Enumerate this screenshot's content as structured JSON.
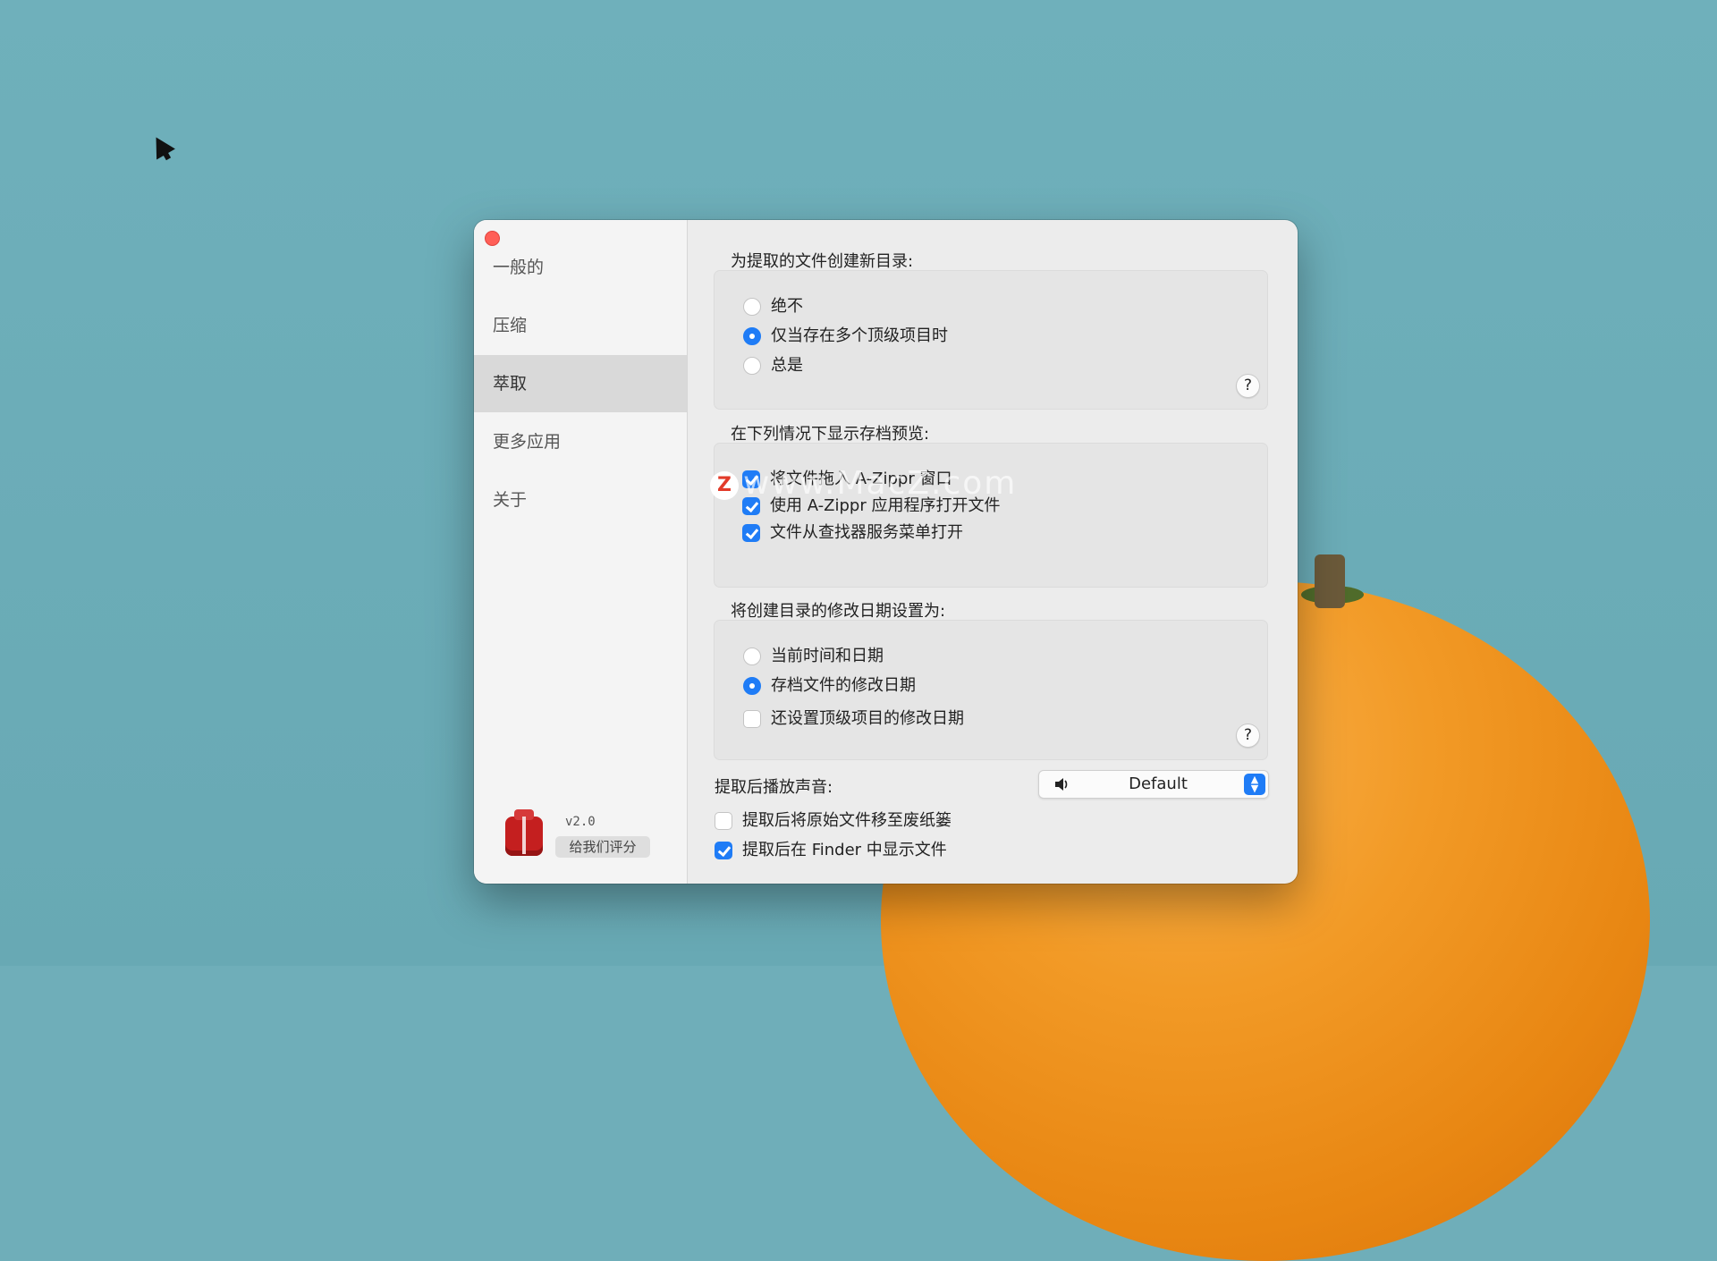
{
  "sidebar": {
    "items": [
      {
        "label": "一般的"
      },
      {
        "label": "压缩"
      },
      {
        "label": "萃取"
      },
      {
        "label": "更多应用"
      },
      {
        "label": "关于"
      }
    ],
    "active_index": 2,
    "version": "v2.0",
    "rate_button": "给我们评分"
  },
  "main": {
    "create_dir": {
      "title": "为提取的文件创建新目录:",
      "options": [
        {
          "label": "绝不",
          "selected": false
        },
        {
          "label": "仅当存在多个顶级项目时",
          "selected": true
        },
        {
          "label": "总是",
          "selected": false
        }
      ],
      "help": "?"
    },
    "preview": {
      "title": "在下列情况下显示存档预览:",
      "options": [
        {
          "label": "将文件拖入 A-Zippr 窗口",
          "checked": true
        },
        {
          "label": "使用 A-Zippr 应用程序打开文件",
          "checked": true
        },
        {
          "label": "文件从查找器服务菜单打开",
          "checked": true
        }
      ]
    },
    "mod_date": {
      "title": "将创建目录的修改日期设置为:",
      "options": [
        {
          "label": "当前时间和日期",
          "selected": false
        },
        {
          "label": "存档文件的修改日期",
          "selected": true
        }
      ],
      "also_set": {
        "label": "还设置顶级项目的修改日期",
        "checked": false
      },
      "help": "?"
    },
    "sound": {
      "label": "提取后播放声音:",
      "value": "Default"
    },
    "trash_original": {
      "label": "提取后将原始文件移至废纸篓",
      "checked": false
    },
    "show_in_finder": {
      "label": "提取后在 Finder 中显示文件",
      "checked": true
    }
  },
  "watermark": {
    "logo": "Z",
    "text": "www.MacZ.com"
  },
  "colors": {
    "accent": "#1f7cf6",
    "close": "#ff5f57",
    "desktop": "#6faeb9"
  }
}
